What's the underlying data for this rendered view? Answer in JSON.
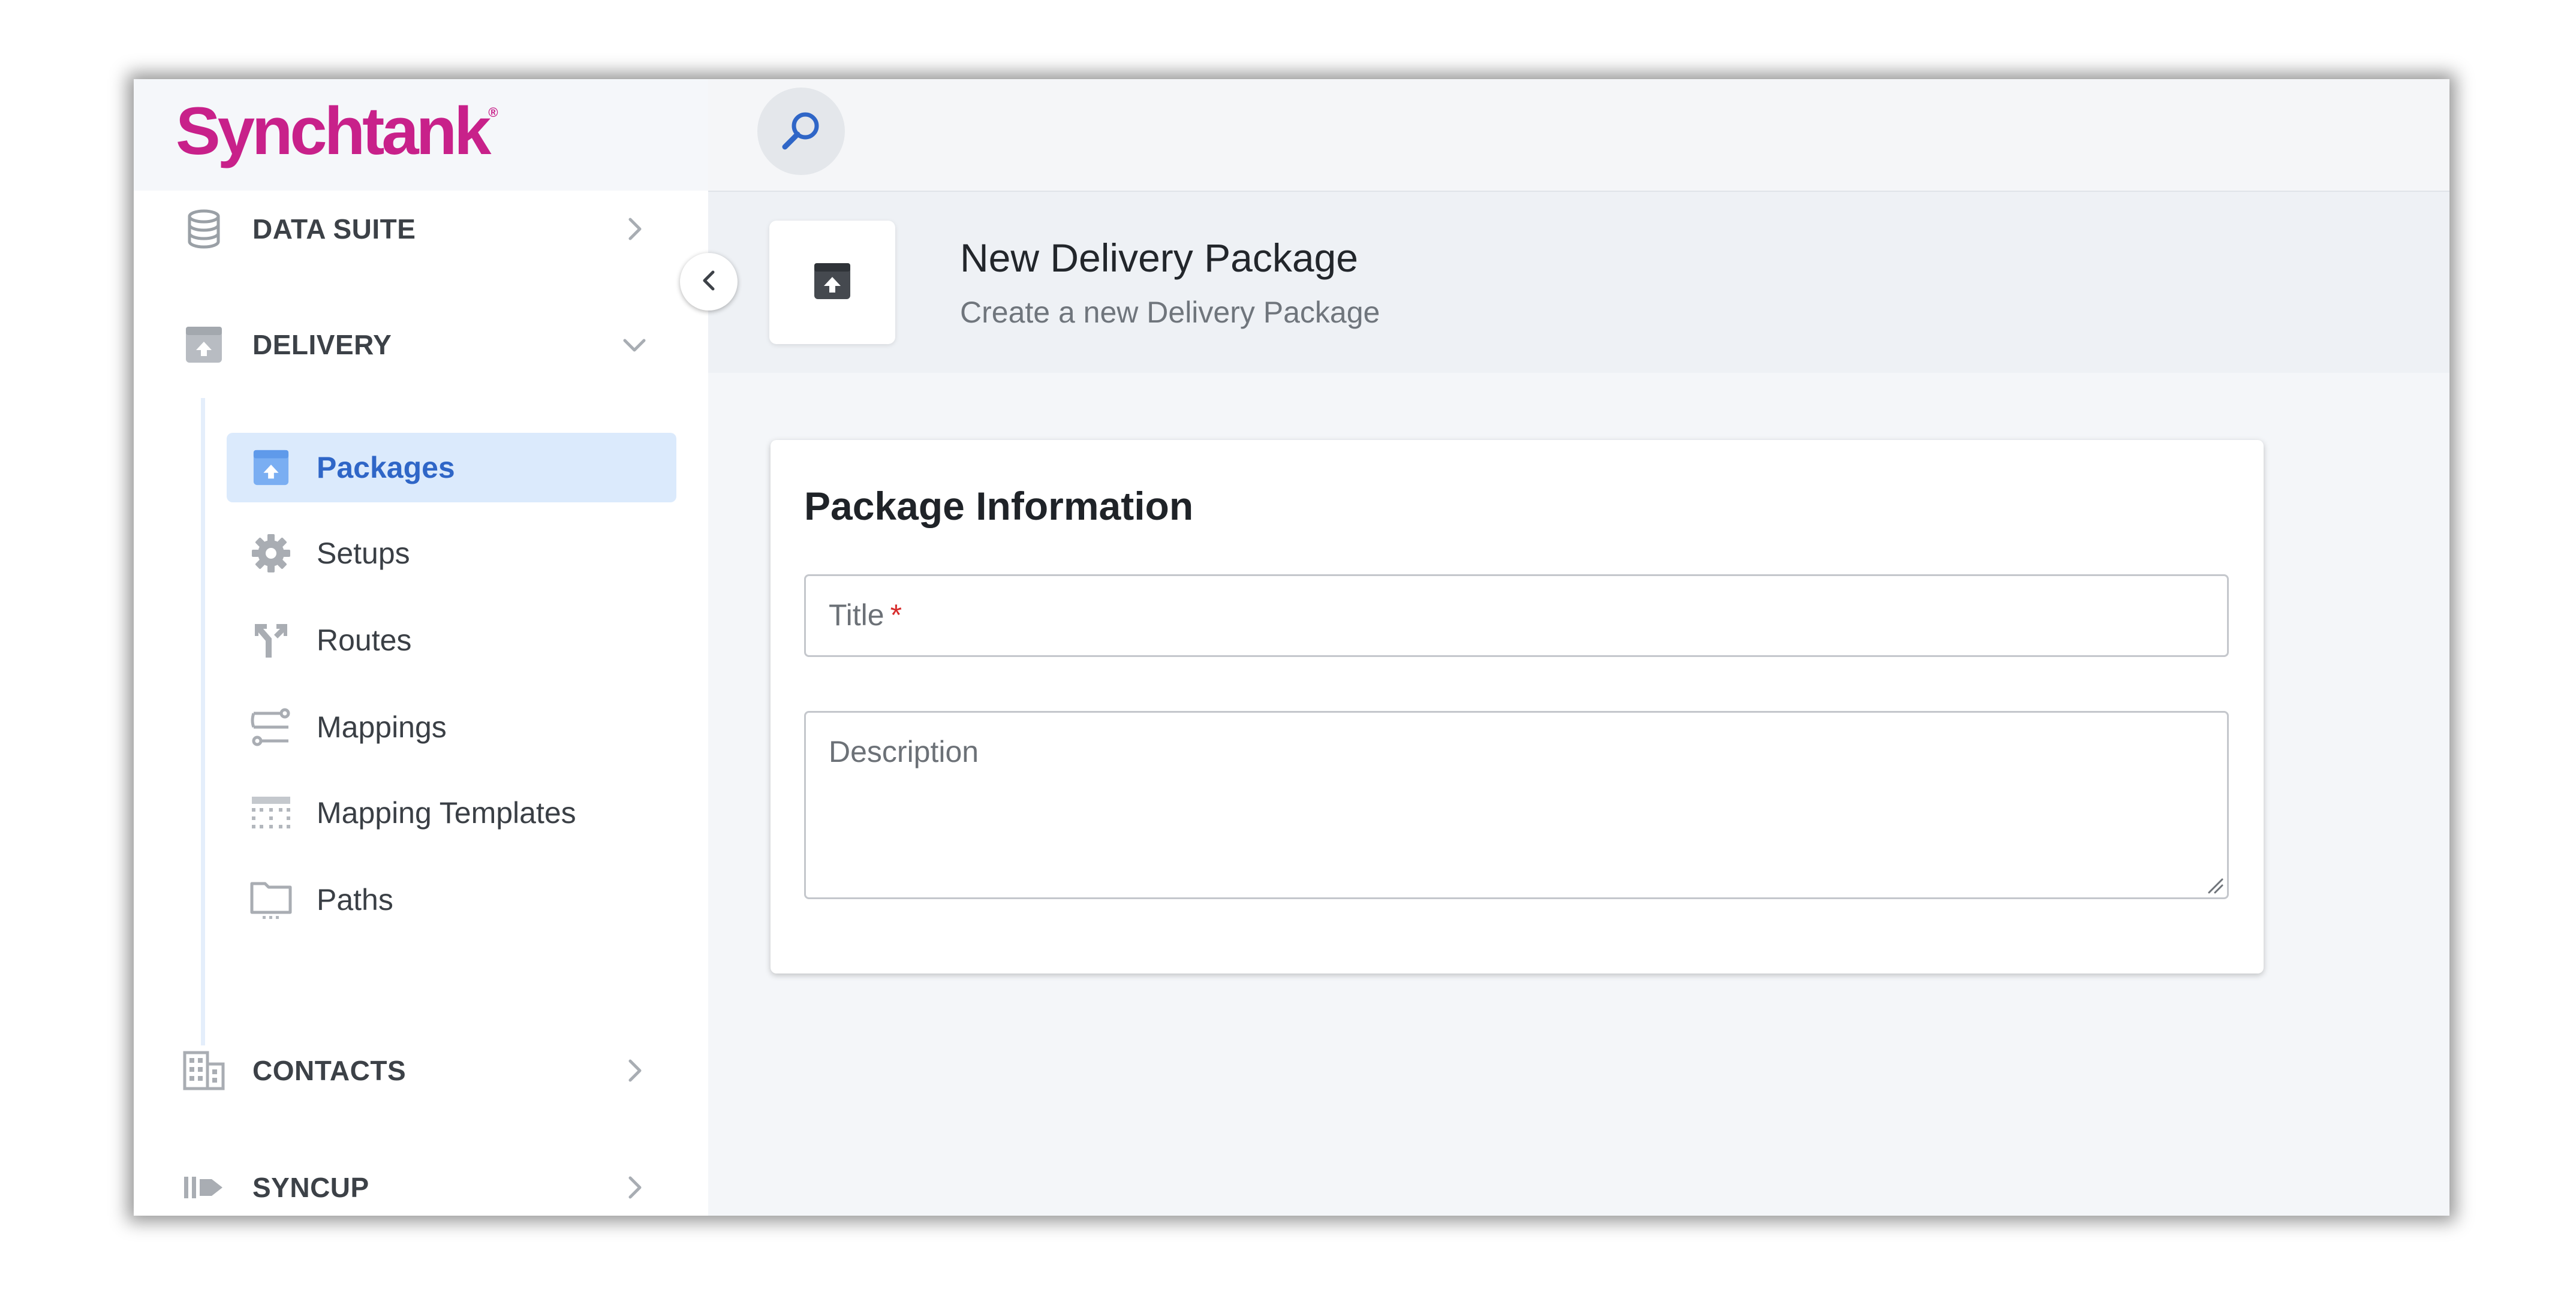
{
  "app": {
    "logo_text": "Synchtank",
    "logo_reg": "®"
  },
  "sidebar": {
    "sections": [
      {
        "label": "DATA SUITE",
        "icon": "database-icon",
        "expanded": false
      },
      {
        "label": "DELIVERY",
        "icon": "archive-box-icon",
        "expanded": true
      },
      {
        "label": "CONTACTS",
        "icon": "building-icon",
        "expanded": false
      },
      {
        "label": "SYNCUP",
        "icon": "syncup-icon",
        "expanded": false
      }
    ],
    "delivery_items": [
      {
        "label": "Packages",
        "icon": "archive-box-icon",
        "active": true
      },
      {
        "label": "Setups",
        "icon": "gear-icon",
        "active": false
      },
      {
        "label": "Routes",
        "icon": "route-split-icon",
        "active": false
      },
      {
        "label": "Mappings",
        "icon": "mapping-icon",
        "active": false
      },
      {
        "label": "Mapping Templates",
        "icon": "table-template-icon",
        "active": false
      },
      {
        "label": "Paths",
        "icon": "folder-icon",
        "active": false
      }
    ]
  },
  "header": {
    "title": "New Delivery Package",
    "subtitle": "Create a new Delivery Package"
  },
  "form": {
    "card_title": "Package Information",
    "title_label": "Title",
    "title_required_mark": "*",
    "title_value": "",
    "description_label": "Description",
    "description_value": ""
  },
  "colors": {
    "brand": "#c8218a",
    "accent": "#2f66c7",
    "active_bg": "#dbeafc",
    "required": "#d72c2c"
  }
}
